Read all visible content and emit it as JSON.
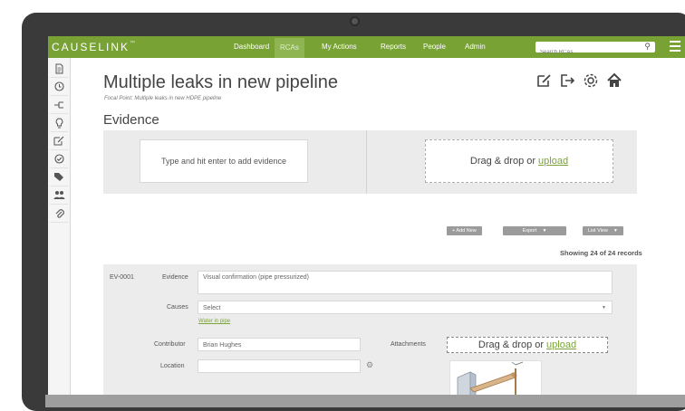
{
  "app": {
    "logo_main": "CAUSELINK",
    "logo_mark": "™"
  },
  "nav": {
    "items": [
      {
        "label": "Dashboard"
      },
      {
        "label": "RCAs"
      },
      {
        "label": "My Actions"
      },
      {
        "label": "Reports"
      },
      {
        "label": "People"
      },
      {
        "label": "Admin"
      }
    ],
    "active": "RCAs",
    "search_placeholder": "Search RCAs"
  },
  "sidebar": {
    "icons": [
      "document-icon",
      "clock-icon",
      "tree-icon",
      "lightbulb-icon",
      "edit-icon",
      "check-circle-icon",
      "tags-icon",
      "people-icon",
      "attachment-icon"
    ]
  },
  "header": {
    "title": "Multiple leaks in new pipeline",
    "focal_point": "Focal Point: Multiple leaks in new HDPE pipeline",
    "icons": [
      "edit-icon",
      "export-icon",
      "settings-icon",
      "home-icon"
    ]
  },
  "evidence": {
    "section_title": "Evidence",
    "add_placeholder": "Type and hit enter to add evidence",
    "drop_text": "Drag & drop or",
    "upload_link": "upload"
  },
  "toolbar": {
    "add_new": "+ Add New",
    "export": "Export",
    "list_view": "List View"
  },
  "records_status": "Showing 24 of 24 records",
  "record": {
    "id": "EV-0001",
    "evidence_label": "Evidence",
    "evidence_value": "Visual confirmation (pipe pressurized)",
    "causes_label": "Causes",
    "causes_select": "Select",
    "cause_link": "Water in pipe",
    "contributor_label": "Contributor",
    "contributor_value": "Brian Hughes",
    "attachments_label": "Attachments",
    "attach_drop_text": "Drag & drop or",
    "attach_upload_link": "upload",
    "location_label": "Location",
    "location_value": ""
  },
  "colors": {
    "brand": "#78a234",
    "brand_active": "#8fb552",
    "link": "#7aa537"
  }
}
